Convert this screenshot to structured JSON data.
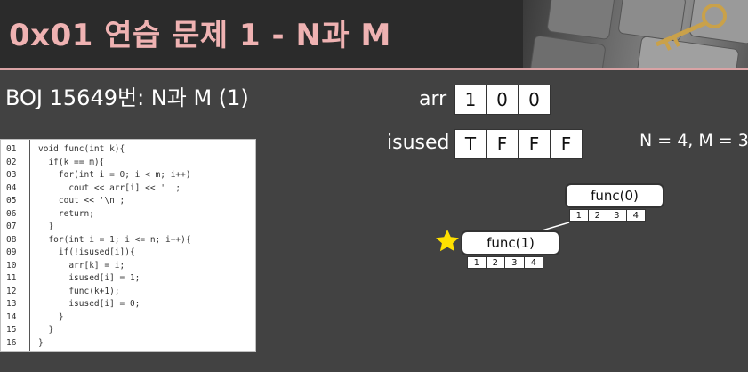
{
  "header": {
    "title": "0x01  연습 문제 1 - N과 M"
  },
  "subtitle": "BOJ 15649번: N과 M (1)",
  "code": {
    "line_numbers": [
      "01",
      "02",
      "03",
      "04",
      "05",
      "06",
      "07",
      "08",
      "09",
      "10",
      "11",
      "12",
      "13",
      "14",
      "15",
      "16"
    ],
    "lines": [
      "void func(int k){",
      "  if(k == m){",
      "    for(int i = 0; i < m; i++)",
      "      cout << arr[i] << ' ';",
      "    cout << '\\n';",
      "    return;",
      "  }",
      "  for(int i = 1; i <= n; i++){",
      "    if(!isused[i]){",
      "      arr[k] = i;",
      "      isused[i] = 1;",
      "      func(k+1);",
      "      isused[i] = 0;",
      "    }",
      "  }",
      "}"
    ]
  },
  "arr": {
    "label": "arr",
    "values": [
      "1",
      "0",
      "0"
    ]
  },
  "isused": {
    "label": "isused",
    "values": [
      "T",
      "F",
      "F",
      "F"
    ]
  },
  "params": "N = 4, M = 3",
  "tree": {
    "nodes": [
      {
        "label": "func(0)",
        "indices": [
          "1",
          "2",
          "3",
          "4"
        ]
      },
      {
        "label": "func(1)",
        "indices": [
          "1",
          "2",
          "3",
          "4"
        ]
      }
    ]
  },
  "colors": {
    "header_text": "#efb2b2",
    "accent_line": "#d9a3a5",
    "star": "#ffe000",
    "background": "#424242"
  }
}
